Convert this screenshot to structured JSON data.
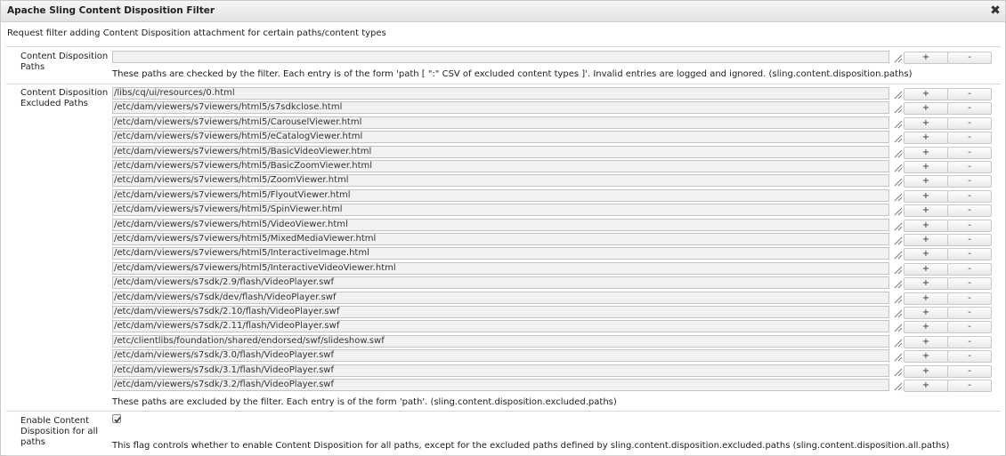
{
  "dialog": {
    "title": "Apache Sling Content Disposition Filter",
    "close_glyph": "✖",
    "description": "Request filter adding Content Disposition attachment for certain paths/content types"
  },
  "paths": {
    "label": "Content Disposition Paths",
    "values": [
      ""
    ],
    "help": "These paths are checked by the filter. Each entry is of the form 'path [ \":\" CSV of excluded content types ]'. Invalid entries are logged and ignored. (sling.content.disposition.paths)"
  },
  "excluded": {
    "label": "Content Disposition Excluded Paths",
    "values": [
      "/libs/cq/ui/resources/0.html",
      "/etc/dam/viewers/s7viewers/html5/s7sdkclose.html",
      "/etc/dam/viewers/s7viewers/html5/CarouselViewer.html",
      "/etc/dam/viewers/s7viewers/html5/eCatalogViewer.html",
      "/etc/dam/viewers/s7viewers/html5/BasicVideoViewer.html",
      "/etc/dam/viewers/s7viewers/html5/BasicZoomViewer.html",
      "/etc/dam/viewers/s7viewers/html5/ZoomViewer.html",
      "/etc/dam/viewers/s7viewers/html5/FlyoutViewer.html",
      "/etc/dam/viewers/s7viewers/html5/SpinViewer.html",
      "/etc/dam/viewers/s7viewers/html5/VideoViewer.html",
      "/etc/dam/viewers/s7viewers/html5/MixedMediaViewer.html",
      "/etc/dam/viewers/s7viewers/html5/InteractiveImage.html",
      "/etc/dam/viewers/s7viewers/html5/InteractiveVideoViewer.html",
      "/etc/dam/viewers/s7sdk/2.9/flash/VideoPlayer.swf",
      "/etc/dam/viewers/s7sdk/dev/flash/VideoPlayer.swf",
      "/etc/dam/viewers/s7sdk/2.10/flash/VideoPlayer.swf",
      "/etc/dam/viewers/s7sdk/2.11/flash/VideoPlayer.swf",
      "/etc/clientlibs/foundation/shared/endorsed/swf/slideshow.swf",
      "/etc/dam/viewers/s7sdk/3.0/flash/VideoPlayer.swf",
      "/etc/dam/viewers/s7sdk/3.1/flash/VideoPlayer.swf",
      "/etc/dam/viewers/s7sdk/3.2/flash/VideoPlayer.swf"
    ],
    "help": "These paths are excluded by the filter. Each entry is of the form 'path'. (sling.content.disposition.excluded.paths)"
  },
  "all_paths": {
    "label": "Enable Content Disposition for all paths",
    "checked": true,
    "help": "This flag controls whether to enable Content Disposition for all paths, except for the excluded paths defined by sling.content.disposition.excluded.paths (sling.content.disposition.all.paths)"
  },
  "buttons": {
    "add_label": "+",
    "remove_label": "-"
  }
}
